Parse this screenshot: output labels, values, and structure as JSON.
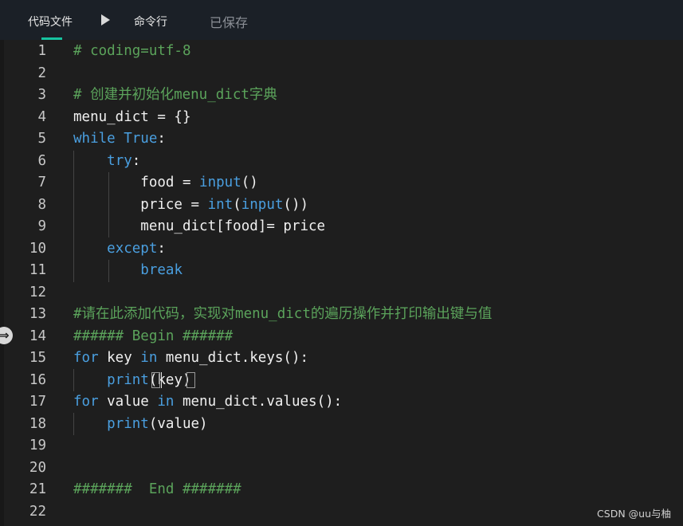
{
  "toolbar": {
    "tab_code": "代码文件",
    "tab_cmd": "命令行",
    "saved_status": "已保存",
    "run_icon": "play-icon"
  },
  "watermark": "CSDN @uu与柚",
  "editor": {
    "lines": [
      {
        "n": "1",
        "segs": [
          {
            "t": "# coding=utf-8",
            "c": "comment"
          }
        ]
      },
      {
        "n": "2",
        "segs": []
      },
      {
        "n": "3",
        "segs": [
          {
            "t": "# 创建并初始化menu_dict字典",
            "c": "comment"
          }
        ]
      },
      {
        "n": "4",
        "segs": [
          {
            "t": "menu_dict = {}",
            "c": "plain"
          }
        ]
      },
      {
        "n": "5",
        "segs": [
          {
            "t": "while",
            "c": "kw"
          },
          {
            "t": " ",
            "c": "plain"
          },
          {
            "t": "True",
            "c": "kw"
          },
          {
            "t": ":",
            "c": "plain"
          }
        ]
      },
      {
        "n": "6",
        "segs": [
          {
            "t": "    ",
            "c": "plain"
          },
          {
            "t": "try",
            "c": "kw"
          },
          {
            "t": ":",
            "c": "plain"
          }
        ]
      },
      {
        "n": "7",
        "segs": [
          {
            "t": "        food = ",
            "c": "plain"
          },
          {
            "t": "input",
            "c": "call"
          },
          {
            "t": "()",
            "c": "plain"
          }
        ]
      },
      {
        "n": "8",
        "segs": [
          {
            "t": "        price = ",
            "c": "plain"
          },
          {
            "t": "int",
            "c": "call"
          },
          {
            "t": "(",
            "c": "plain"
          },
          {
            "t": "input",
            "c": "call"
          },
          {
            "t": "())",
            "c": "plain"
          }
        ]
      },
      {
        "n": "9",
        "segs": [
          {
            "t": "        menu_dict[food]= price",
            "c": "plain"
          }
        ]
      },
      {
        "n": "10",
        "segs": [
          {
            "t": "    ",
            "c": "plain"
          },
          {
            "t": "except",
            "c": "kw"
          },
          {
            "t": ":",
            "c": "plain"
          }
        ]
      },
      {
        "n": "11",
        "segs": [
          {
            "t": "        ",
            "c": "plain"
          },
          {
            "t": "break",
            "c": "kw"
          }
        ]
      },
      {
        "n": "12",
        "segs": []
      },
      {
        "n": "13",
        "segs": [
          {
            "t": "#请在此添加代码，实现对menu_dict的遍历操作并打印输出键与值",
            "c": "comment"
          }
        ]
      },
      {
        "n": "14",
        "segs": [
          {
            "t": "###### Begin ######",
            "c": "comment"
          }
        ]
      },
      {
        "n": "15",
        "segs": [
          {
            "t": "for",
            "c": "kw"
          },
          {
            "t": " key ",
            "c": "plain"
          },
          {
            "t": "in",
            "c": "kw"
          },
          {
            "t": " menu_dict.keys():",
            "c": "plain"
          }
        ]
      },
      {
        "n": "16",
        "segs": [
          {
            "t": "    ",
            "c": "plain"
          },
          {
            "t": "print",
            "c": "call"
          },
          {
            "t": "(key)",
            "c": "plain"
          }
        ]
      },
      {
        "n": "17",
        "segs": [
          {
            "t": "for",
            "c": "kw"
          },
          {
            "t": " value ",
            "c": "plain"
          },
          {
            "t": "in",
            "c": "kw"
          },
          {
            "t": " menu_dict.values():",
            "c": "plain"
          }
        ]
      },
      {
        "n": "18",
        "segs": [
          {
            "t": "    ",
            "c": "plain"
          },
          {
            "t": "print",
            "c": "call"
          },
          {
            "t": "(value)",
            "c": "plain"
          }
        ]
      },
      {
        "n": "19",
        "segs": []
      },
      {
        "n": "20",
        "segs": []
      },
      {
        "n": "21",
        "segs": [
          {
            "t": "#######  End #######",
            "c": "comment"
          }
        ]
      },
      {
        "n": "22",
        "segs": []
      }
    ]
  },
  "colors": {
    "background": "#1e1e1e",
    "comment": "#5ba35b",
    "keyword": "#4a9fe0",
    "plain": "#f0f0f0",
    "accent": "#16c3a0"
  }
}
